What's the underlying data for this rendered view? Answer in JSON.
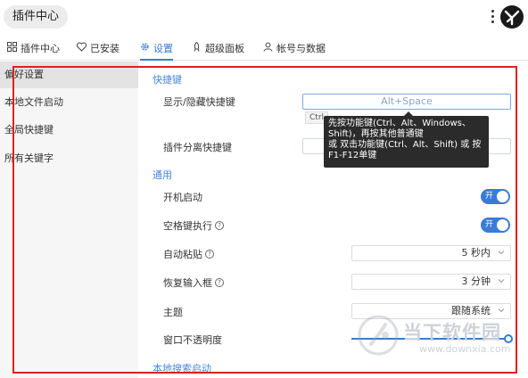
{
  "window": {
    "title": "插件中心"
  },
  "tabs": [
    {
      "label": "插件中心",
      "icon": "grid-icon",
      "active": false
    },
    {
      "label": "已安装",
      "icon": "heart-icon",
      "active": false
    },
    {
      "label": "设置",
      "icon": "gear-icon",
      "active": true
    },
    {
      "label": "超级面板",
      "icon": "rocket-icon",
      "active": false
    },
    {
      "label": "帐号与数据",
      "icon": "user-icon",
      "active": false
    }
  ],
  "sidebar": {
    "items": [
      {
        "label": "偏好设置",
        "active": true
      },
      {
        "label": "本地文件启动",
        "active": false
      },
      {
        "label": "全局快捷键",
        "active": false
      },
      {
        "label": "所有关键字",
        "active": false
      }
    ]
  },
  "hotkeys": {
    "section": "快捷键",
    "show_hide_label": "显示/隐藏快捷键",
    "show_hide_value": "Alt+Space",
    "ctrl_hint": "Ctrl",
    "detach_label": "插件分离快捷键"
  },
  "tooltip": {
    "lines": [
      "先按功能键(Ctrl、Alt、Windows、",
      "Shift)，再按其他普通键",
      "或 双击功能键(Ctrl、Alt、Shift) 或 按",
      "F1-F12单键"
    ]
  },
  "general": {
    "section": "通用",
    "autostart_label": "开机启动",
    "autostart_value": "开",
    "space_exec_label": "空格键执行",
    "space_exec_value": "开",
    "autopaste_label": "自动粘贴",
    "autopaste_value": "5 秒内",
    "restore_input_label": "恢复输入框",
    "restore_input_value": "3 分钟",
    "theme_label": "主题",
    "theme_value": "跟随系统",
    "opacity_label": "窗口不透明度",
    "opacity_value": 1.0
  },
  "local_search": {
    "section": "本地搜索启动"
  },
  "watermark": {
    "brand": "当下软件园",
    "url": "www.downxia.com"
  },
  "colors": {
    "accent": "#3a7bd5",
    "highlight_frame": "#e02020"
  }
}
